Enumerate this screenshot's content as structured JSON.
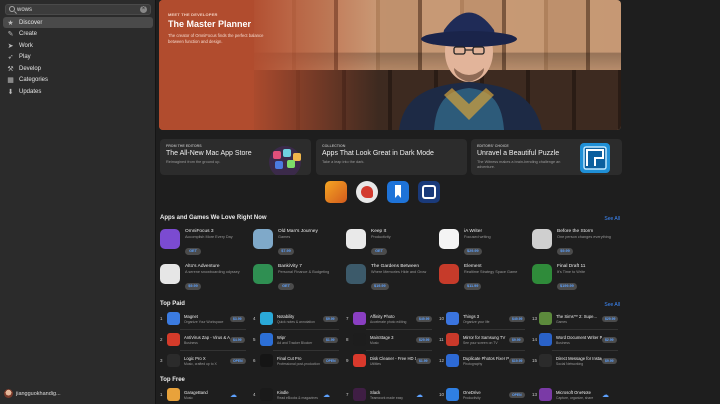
{
  "search": {
    "value": "wows",
    "clear": "×"
  },
  "sidebar": {
    "items": [
      {
        "label": "Discover",
        "icon": "star-icon",
        "glyph": "★"
      },
      {
        "label": "Create",
        "icon": "brush-icon",
        "glyph": "✎"
      },
      {
        "label": "Work",
        "icon": "paperplane-icon",
        "glyph": "➤"
      },
      {
        "label": "Play",
        "icon": "rocket-icon",
        "glyph": "➶"
      },
      {
        "label": "Develop",
        "icon": "hammer-icon",
        "glyph": "⚒"
      },
      {
        "label": "Categories",
        "icon": "grid-icon",
        "glyph": "▦"
      },
      {
        "label": "Updates",
        "icon": "download-icon",
        "glyph": "⬇"
      }
    ],
    "user": "jiangguokhandig..."
  },
  "hero": {
    "eyebrow": "MEET THE DEVELOPER",
    "title": "The Master Planner",
    "description": "The creator of OmniFocus finds the perfect balance between function and design."
  },
  "cards": [
    {
      "kicker": "FROM THE EDITORS",
      "title": "The All-New Mac App Store",
      "desc": "Reimagined from the ground up."
    },
    {
      "kicker": "COLLECTION",
      "title": "Apps That Look Great in Dark Mode",
      "desc": "Take a leap into the dark."
    },
    {
      "kicker": "EDITORS' CHOICE",
      "title": "Unravel a Beautiful Puzzle",
      "desc": "The Witness makes a brain-bending challenge an adventure."
    }
  ],
  "sections": {
    "love": {
      "title": "Apps and Games We Love Right Now",
      "see_all": "See All"
    },
    "paid": {
      "title": "Top Paid",
      "see_all": "See All"
    },
    "free": {
      "title": "Top Free"
    }
  },
  "love_apps": [
    {
      "name": "OmniFocus 3",
      "sub": "Accomplish More Every Day",
      "btn": "GET",
      "color": "#7b4bd1"
    },
    {
      "name": "Old Man's Journey",
      "sub": "Games",
      "btn": "$7.99",
      "color": "#7fa9c9"
    },
    {
      "name": "Keep It",
      "sub": "Productivity",
      "btn": "GET",
      "color": "#e9e9e9"
    },
    {
      "name": "iA Writer",
      "sub": "Focused writing",
      "btn": "$29.99",
      "color": "#f4f4f4"
    },
    {
      "name": "Before the Storm",
      "sub": "One person changes everything",
      "btn": "$9.99",
      "color": "#cfcfcf"
    },
    {
      "name": "Alto's Adventure",
      "sub": "A serene snowboarding odyssey",
      "btn": "$9.99",
      "color": "#e6e6e6"
    },
    {
      "name": "BankiVity 7",
      "sub": "Personal Finance & Budgeting",
      "btn": "GET",
      "color": "#2f8f52"
    },
    {
      "name": "The Gardens Between",
      "sub": "Where Memories Hide and Grow",
      "btn": "$19.99",
      "color": "#3c5a6a"
    },
    {
      "name": "Element",
      "sub": "Realtime Strategy Space Game",
      "btn": "$11.99",
      "color": "#c63b2a"
    },
    {
      "name": "Final Draft 11",
      "sub": "It's Time to Write",
      "btn": "$199.99",
      "color": "#2f8b3a"
    }
  ],
  "paid": [
    {
      "n": "1",
      "name": "Magnet",
      "sub": "Organize Your Workspace",
      "btn": "$3.99",
      "color": "#3b7be0"
    },
    {
      "n": "4",
      "name": "Notability",
      "sub": "Quick notes & annotation",
      "btn": "$9.99",
      "color": "#2aa9d8"
    },
    {
      "n": "7",
      "name": "Affinity Photo",
      "sub": "Accelerate photo editing",
      "btn": "$49.99",
      "color": "#8a3fc2"
    },
    {
      "n": "10",
      "name": "Things 3",
      "sub": "Organize your life",
      "btn": "$49.99",
      "color": "#3a74de"
    },
    {
      "n": "13",
      "name": "The Sims™ 2: Supe...",
      "sub": "Games",
      "btn": "$29.99",
      "color": "#5c8a3c"
    },
    {
      "n": "2",
      "name": "AntiVirus Zap - Virus & Adware",
      "sub": "Business",
      "btn": "$4.99",
      "color": "#d43b2a"
    },
    {
      "n": "5",
      "name": "Wipr",
      "sub": "Ad and Tracker Blocker",
      "btn": "$1.99",
      "color": "#2c6fd6"
    },
    {
      "n": "8",
      "name": "MainStage 3",
      "sub": "Music",
      "btn": "$29.99",
      "color": "#1d1d1d"
    },
    {
      "n": "11",
      "name": "Mirror for Samsung TV",
      "sub": "See your screen on TV",
      "btn": "$9.99",
      "color": "#c9392a"
    },
    {
      "n": "14",
      "name": "Word Document Writer Pro",
      "sub": "Business",
      "btn": "$2.99",
      "color": "#2a62c8"
    },
    {
      "n": "3",
      "name": "Logic Pro X",
      "sub": "Music, crafted up to X",
      "btn": "OPEN",
      "color": "#2b2b2b"
    },
    {
      "n": "6",
      "name": "Final Cut Pro",
      "sub": "Professional post-production",
      "btn": "OPEN",
      "color": "#151515"
    },
    {
      "n": "9",
      "name": "Disk Cleaner - Free HD Space",
      "sub": "Utilities",
      "btn": "$1.99",
      "color": "#d9392c"
    },
    {
      "n": "12",
      "name": "Duplicate Photos Fixer Pro",
      "sub": "Photography",
      "btn": "$19.99",
      "color": "#2d6ad5"
    },
    {
      "n": "15",
      "name": "Direct Message for Instagram",
      "sub": "Social Networking",
      "btn": "$9.99",
      "color": "#2b2b2b"
    }
  ],
  "free": [
    {
      "n": "1",
      "name": "GarageBand",
      "sub": "Music",
      "color": "#e8a23b"
    },
    {
      "n": "4",
      "name": "Kindle",
      "sub": "Read eBooks & magazines",
      "color": "#1a1a1a"
    },
    {
      "n": "7",
      "name": "Slack",
      "sub": "Teamwork made easy",
      "color": "#3f1e44"
    },
    {
      "n": "10",
      "name": "OneDrive",
      "sub": "Productivity",
      "btn": "OPEN",
      "color": "#2f7fe2"
    },
    {
      "n": "13",
      "name": "Microsoft OneNote",
      "sub": "Capture, organize, share",
      "color": "#7a3aa6"
    }
  ]
}
